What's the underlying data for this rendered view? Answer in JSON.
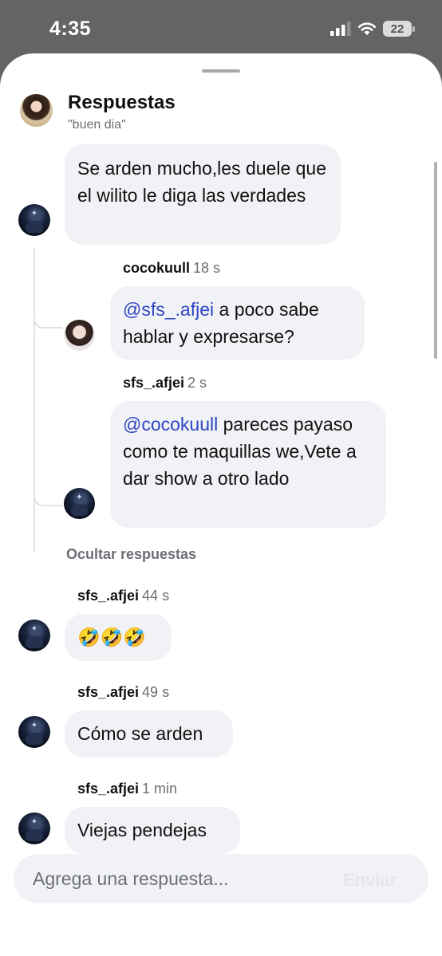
{
  "status_bar": {
    "time": "4:35",
    "battery": "22"
  },
  "header": {
    "title": "Respuestas",
    "subtitle": "\"buen dia\""
  },
  "root_comment": {
    "text": "Se arden mucho,les duele que el wilito le diga las verdades"
  },
  "replies": [
    {
      "user": "cocokuull",
      "ago": "18 s",
      "mention": "@sfs_.afjei",
      "text": " a poco sabe hablar y expresarse?"
    },
    {
      "user": "sfs_.afjei",
      "ago": "2 s",
      "mention": "@cocokuull",
      "text": " pareces payaso como te maquillas we,Vete a dar show a otro lado"
    }
  ],
  "hide_replies": "Ocultar respuestas",
  "comments": [
    {
      "user": "sfs_.afjei",
      "ago": "44 s",
      "text": "🤣🤣🤣"
    },
    {
      "user": "sfs_.afjei",
      "ago": "49 s",
      "text": "Cómo se arden"
    },
    {
      "user": "sfs_.afjei",
      "ago": "1 min",
      "text": "Viejas pendejas"
    }
  ],
  "composer": {
    "placeholder": "Agrega una respuesta...",
    "send_label": "Enviar"
  },
  "colors": {
    "mention": "#2f45c4",
    "bubble": "#f0f2f5",
    "muted": "#6c6f75"
  }
}
